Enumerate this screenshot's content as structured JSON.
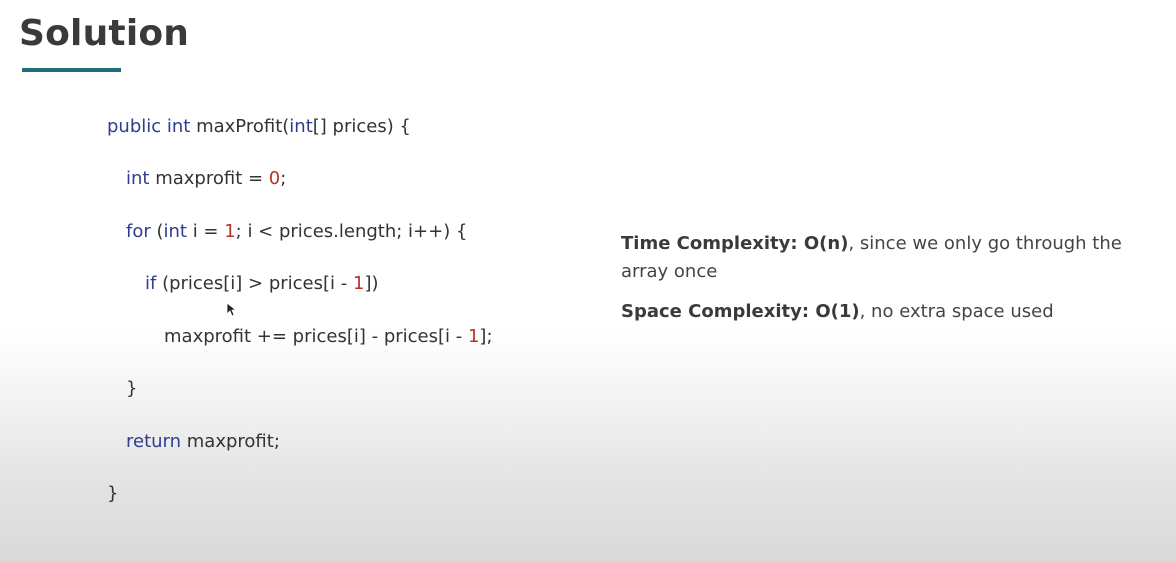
{
  "slide": {
    "title": "Solution",
    "accent_color": "#1f6f78"
  },
  "code": {
    "keyword_color": "#2f3d8f",
    "number_color": "#b83226",
    "lines": [
      [
        {
          "t": "public int",
          "c": "kw"
        },
        {
          "t": " maxProfit(",
          "c": "txt"
        },
        {
          "t": "int",
          "c": "kw"
        },
        {
          "t": "[] prices) {",
          "c": "txt"
        }
      ],
      [
        {
          "t": "int",
          "c": "kw"
        },
        {
          "t": " maxprofit = ",
          "c": "txt"
        },
        {
          "t": "0",
          "c": "num"
        },
        {
          "t": ";",
          "c": "txt"
        }
      ],
      [
        {
          "t": "for",
          "c": "kw"
        },
        {
          "t": " (",
          "c": "txt"
        },
        {
          "t": "int",
          "c": "kw"
        },
        {
          "t": " i = ",
          "c": "txt"
        },
        {
          "t": "1",
          "c": "num"
        },
        {
          "t": "; i < prices.length; i++) {",
          "c": "txt"
        }
      ],
      [
        {
          "t": "if",
          "c": "kw"
        },
        {
          "t": " (prices[i] > prices[i - ",
          "c": "txt"
        },
        {
          "t": "1",
          "c": "num"
        },
        {
          "t": "])",
          "c": "txt"
        }
      ],
      [
        {
          "t": "maxprofit += prices[i] - prices[i - ",
          "c": "txt"
        },
        {
          "t": "1",
          "c": "num"
        },
        {
          "t": "];",
          "c": "txt"
        }
      ],
      [
        {
          "t": "}",
          "c": "txt"
        }
      ],
      [
        {
          "t": "return",
          "c": "kw"
        },
        {
          "t": " maxprofit;",
          "c": "txt"
        }
      ],
      [
        {
          "t": "}",
          "c": "txt"
        }
      ]
    ]
  },
  "notes": {
    "time_label": "Time Complexity",
    "time_value": "O(n)",
    "time_text": ", since we only go through the array once",
    "space_label": "Space Complexity",
    "space_value": "O(1)",
    "space_text": ", no extra space used"
  },
  "icons": {
    "cursor": "mouse-pointer-icon"
  }
}
